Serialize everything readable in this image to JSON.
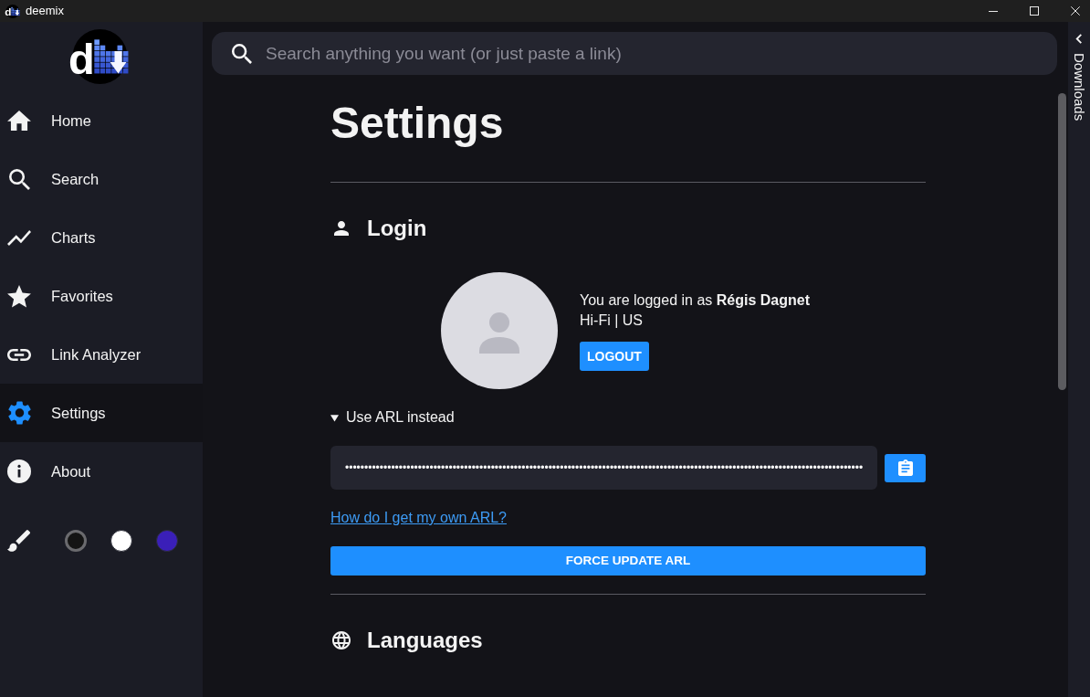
{
  "window": {
    "title": "deemix",
    "icon_text": "d"
  },
  "sidebar": {
    "logo_text": "d",
    "items": [
      {
        "label": "Home",
        "selected": false
      },
      {
        "label": "Search",
        "selected": false
      },
      {
        "label": "Charts",
        "selected": false
      },
      {
        "label": "Favorites",
        "selected": false
      },
      {
        "label": "Link Analyzer",
        "selected": false
      },
      {
        "label": "Settings",
        "selected": true
      },
      {
        "label": "About",
        "selected": false
      }
    ],
    "theme_swatches": [
      {
        "color": "#141414",
        "selected": true
      },
      {
        "color": "#ffffff",
        "selected": false
      },
      {
        "color": "#3a1fb8",
        "selected": false
      }
    ]
  },
  "search": {
    "placeholder": "Search anything you want (or just paste a link)"
  },
  "downloads_panel": {
    "label": "Downloads",
    "expanded": false
  },
  "settings": {
    "title": "Settings",
    "sections": [
      {
        "kind": "login",
        "title": "Login",
        "user_text": "You are logged in as **Régis Dagnet**",
        "plan": "Hi-Fi | US",
        "logout_button": "LOGOUT",
        "arl_toggle": {
          "label": "Use ARL instead",
          "expanded": true
        },
        "arl_value": "•••••••••••••••••••••••••••••••••••••••••••••••••••••••••••••••••••••••••••••••••••••••••••••••••••••••••••••••••••••••••••••••••••••••",
        "help_link": "How do I get my own ARL?",
        "update_button": "FORCE UPDATE ARL"
      },
      {
        "kind": "languages",
        "title": "Languages"
      }
    ]
  }
}
